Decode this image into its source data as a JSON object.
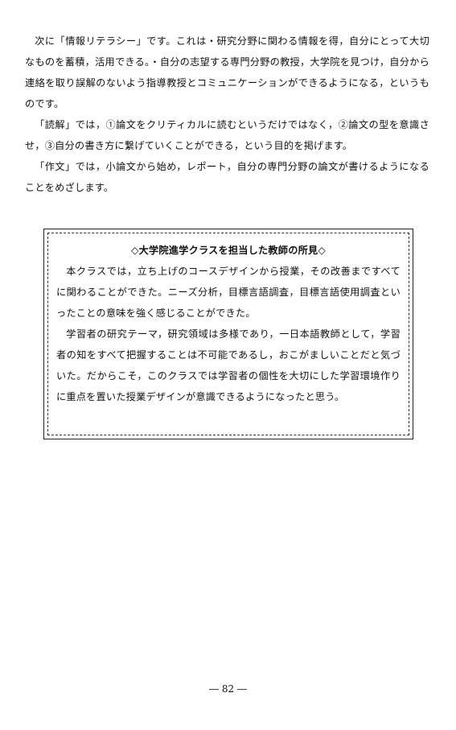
{
  "body": {
    "paragraphs": [
      "次に「情報リテラシー」です。これは・研究分野に関わる情報を得，自分にとって大切なものを蓄積，活用できる。・自分の志望する専門分野の教授，大学院を見つけ，自分から連絡を取り誤解のないよう指導教授とコミュニケーションができるようになる，というものです。",
      "「読解」では，①論文をクリティカルに読むというだけではなく，②論文の型を意識させ，③自分の書き方に繋げていくことができる，という目的を掲げます。",
      "「作文」では，小論文から始め，レポート，自分の専門分野の論文が書けるようになることをめざします。"
    ]
  },
  "box": {
    "title": "◇大学院進学クラスを担当した教師の所見◇",
    "paragraphs": [
      "本クラスでは，立ち上げのコースデザインから授業，その改善まですべてに関わることができた。ニーズ分析，目標言語調査，目標言語使用調査といったことの意味を強く感じることができた。",
      "学習者の研究テーマ，研究領域は多様であり，一日本語教師として，学習者の知をすべて把握することは不可能であるし，おこがましいことだと気づいた。だからこそ，このクラスでは学習者の個性を大切にした学習環境作りに重点を置いた授業デザインが意識できるようになったと思う。"
    ]
  },
  "footer": {
    "page_number": "― 82 ―"
  }
}
